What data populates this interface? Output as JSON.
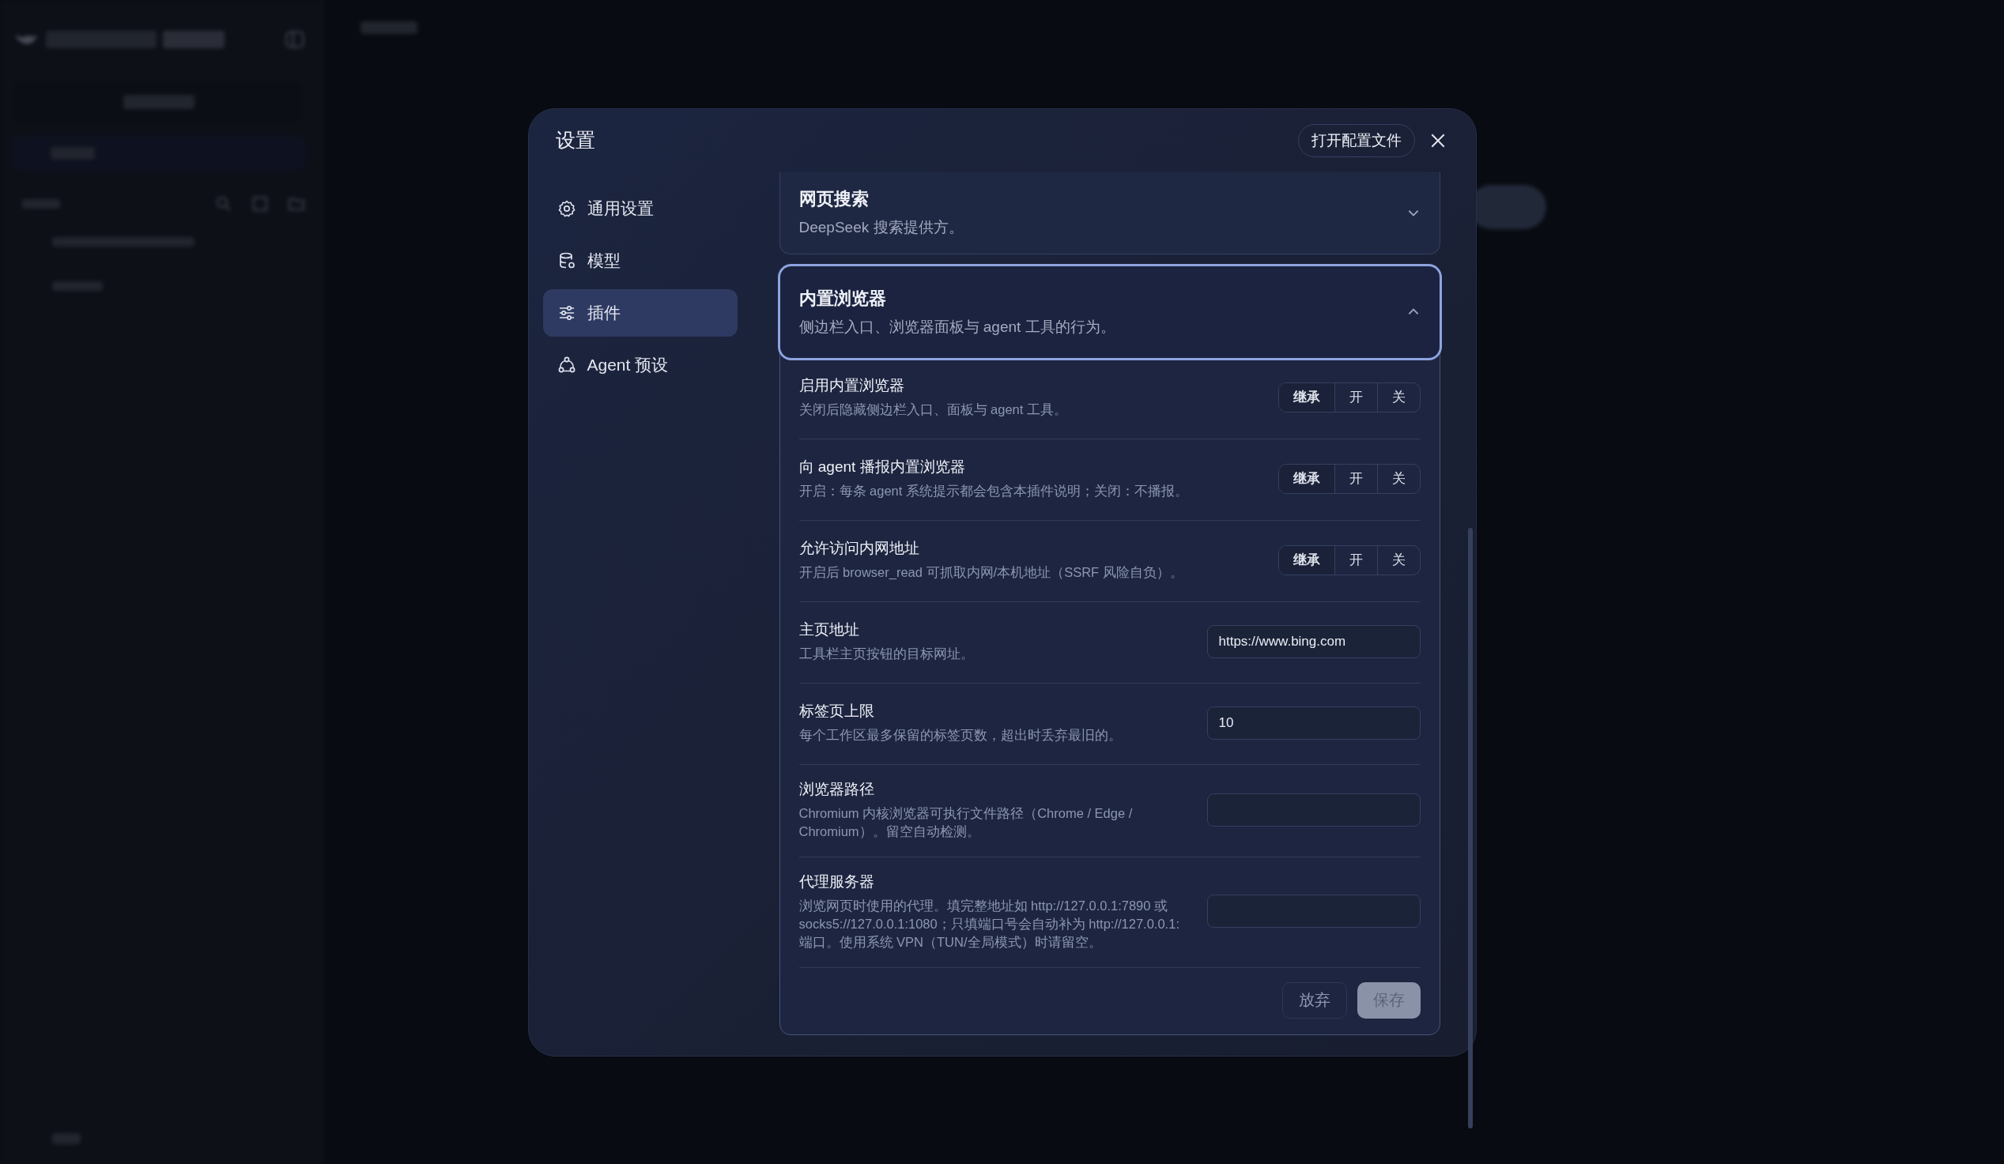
{
  "settings": {
    "title": "设置",
    "open_config_button": "打开配置文件",
    "nav": [
      {
        "label": "通用设置",
        "selected": false
      },
      {
        "label": "模型",
        "selected": false
      },
      {
        "label": "插件",
        "selected": true
      },
      {
        "label": "Agent 预设",
        "selected": false
      }
    ],
    "sections": [
      {
        "title": "网页搜索",
        "description": "DeepSeek 搜索提供方。",
        "expanded": false,
        "focused": false
      },
      {
        "title": "内置浏览器",
        "description": "侧边栏入口、浏览器面板与 agent 工具的行为。",
        "expanded": true,
        "focused": true,
        "rows": [
          {
            "kind": "toggle",
            "title": "启用内置浏览器",
            "description": "关闭后隐藏侧边栏入口、面板与 agent 工具。",
            "options": [
              {
                "label": "继承",
                "selected": true
              },
              {
                "label": "开",
                "selected": false
              },
              {
                "label": "关",
                "selected": false
              }
            ]
          },
          {
            "kind": "toggle",
            "title": "向 agent 播报内置浏览器",
            "description": "开启：每条 agent 系统提示都会包含本插件说明；关闭：不播报。",
            "options": [
              {
                "label": "继承",
                "selected": true
              },
              {
                "label": "开",
                "selected": false
              },
              {
                "label": "关",
                "selected": false
              }
            ]
          },
          {
            "kind": "toggle",
            "title": "允许访问内网地址",
            "description": "开启后 browser_read 可抓取内网/本机地址（SSRF 风险自负）。",
            "options": [
              {
                "label": "继承",
                "selected": true
              },
              {
                "label": "开",
                "selected": false
              },
              {
                "label": "关",
                "selected": false
              }
            ]
          },
          {
            "kind": "input",
            "title": "主页地址",
            "description": "工具栏主页按钮的目标网址。",
            "value": "https://www.bing.com"
          },
          {
            "kind": "input",
            "title": "标签页上限",
            "description": "每个工作区最多保留的标签页数，超出时丢弃最旧的。",
            "value": "10"
          },
          {
            "kind": "input",
            "title": "浏览器路径",
            "description": "Chromium 内核浏览器可执行文件路径（Chrome / Edge / Chromium）。留空自动检测。"
          },
          {
            "kind": "input",
            "title": "代理服务器",
            "description": "浏览网页时使用的代理。填完整地址如 http://127.0.0.1:7890 或 socks5://127.0.0.1:1080；只填端口号会自动补为 http://127.0.0.1:端口。使用系统 VPN（TUN/全局模式）时请留空。"
          }
        ]
      }
    ],
    "discard_button": "放弃",
    "save_button": {
      "label": "保存",
      "disabled": true
    }
  }
}
